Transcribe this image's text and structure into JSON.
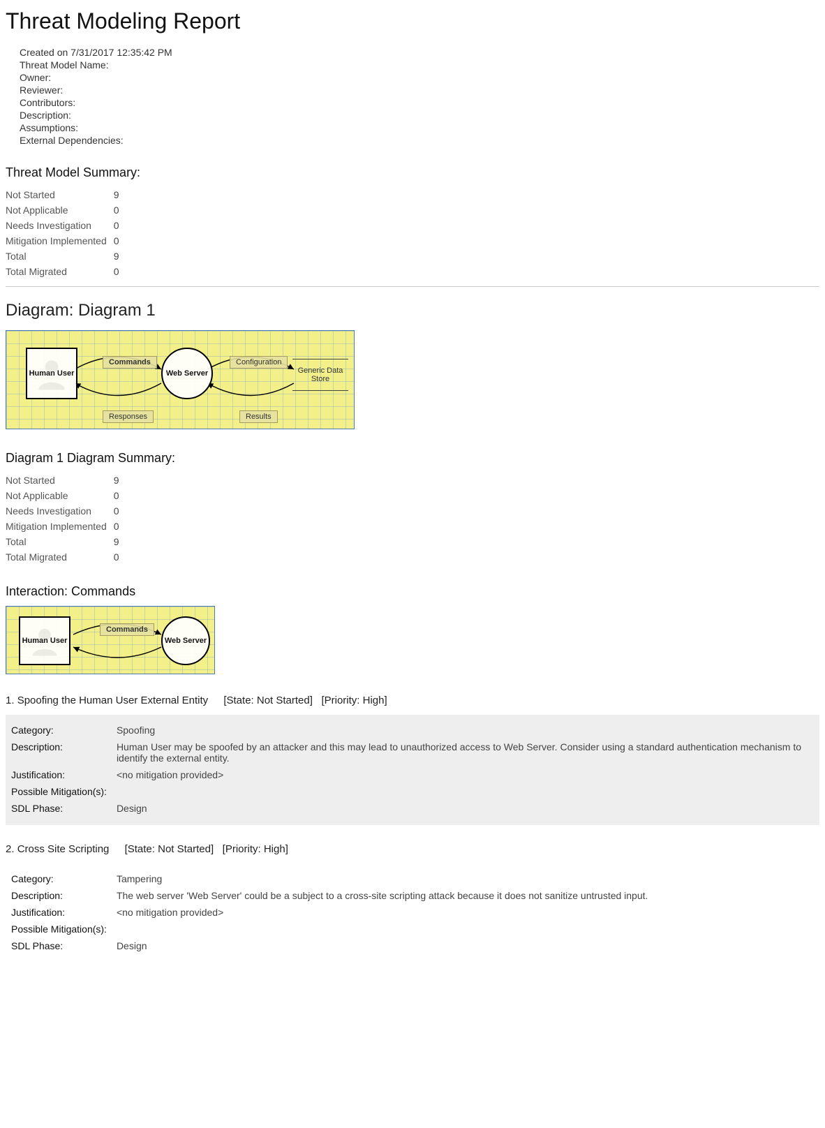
{
  "report": {
    "title": "Threat Modeling Report",
    "created_on": "Created on 7/31/2017 12:35:42 PM",
    "fields": {
      "name_label": "Threat Model Name:",
      "owner_label": "Owner:",
      "reviewer_label": "Reviewer:",
      "contributors_label": "Contributors:",
      "description_label": "Description:",
      "assumptions_label": "Assumptions:",
      "ext_deps_label": "External Dependencies:"
    }
  },
  "summary_title": "Threat Model Summary:",
  "summary": [
    {
      "label": "Not Started",
      "value": "9"
    },
    {
      "label": "Not Applicable",
      "value": "0"
    },
    {
      "label": "Needs Investigation",
      "value": "0"
    },
    {
      "label": "Mitigation Implemented",
      "value": "0"
    },
    {
      "label": "Total",
      "value": "9"
    },
    {
      "label": "Total Migrated",
      "value": "0"
    }
  ],
  "diagram": {
    "title": "Diagram: Diagram 1",
    "nodes": {
      "human_user": "Human User",
      "web_server": "Web Server",
      "data_store": "Generic Data Store"
    },
    "flows": {
      "commands": "Commands",
      "responses": "Responses",
      "configuration": "Configuration",
      "results": "Results"
    },
    "summary_title": "Diagram 1 Diagram Summary:",
    "summary": [
      {
        "label": "Not Started",
        "value": "9"
      },
      {
        "label": "Not Applicable",
        "value": "0"
      },
      {
        "label": "Needs Investigation",
        "value": "0"
      },
      {
        "label": "Mitigation Implemented",
        "value": "0"
      },
      {
        "label": "Total",
        "value": "9"
      },
      {
        "label": "Total Migrated",
        "value": "0"
      }
    ]
  },
  "interaction": {
    "title": "Interaction: Commands"
  },
  "threats": [
    {
      "num": "1.",
      "title": "Spoofing the Human User External Entity",
      "state": "[State: Not Started]",
      "priority": "[Priority: High]",
      "rows": {
        "category_label": "Category:",
        "category": "Spoofing",
        "description_label": "Description:",
        "description": "Human User may be spoofed by an attacker and this may lead to unauthorized access to Web Server. Consider using a standard authentication mechanism to identify the external entity.",
        "justification_label": "Justification:",
        "justification": "<no mitigation provided>",
        "mitigations_label": "Possible Mitigation(s):",
        "mitigations": "",
        "sdl_label": "SDL Phase:",
        "sdl": "Design"
      }
    },
    {
      "num": "2.",
      "title": "Cross Site Scripting",
      "state": "[State: Not Started]",
      "priority": "[Priority: High]",
      "rows": {
        "category_label": "Category:",
        "category": "Tampering",
        "description_label": "Description:",
        "description": "The web server 'Web Server' could be a subject to a cross-site scripting attack because it does not sanitize untrusted input.",
        "justification_label": "Justification:",
        "justification": "<no mitigation provided>",
        "mitigations_label": "Possible Mitigation(s):",
        "mitigations": "",
        "sdl_label": "SDL Phase:",
        "sdl": "Design"
      }
    }
  ]
}
